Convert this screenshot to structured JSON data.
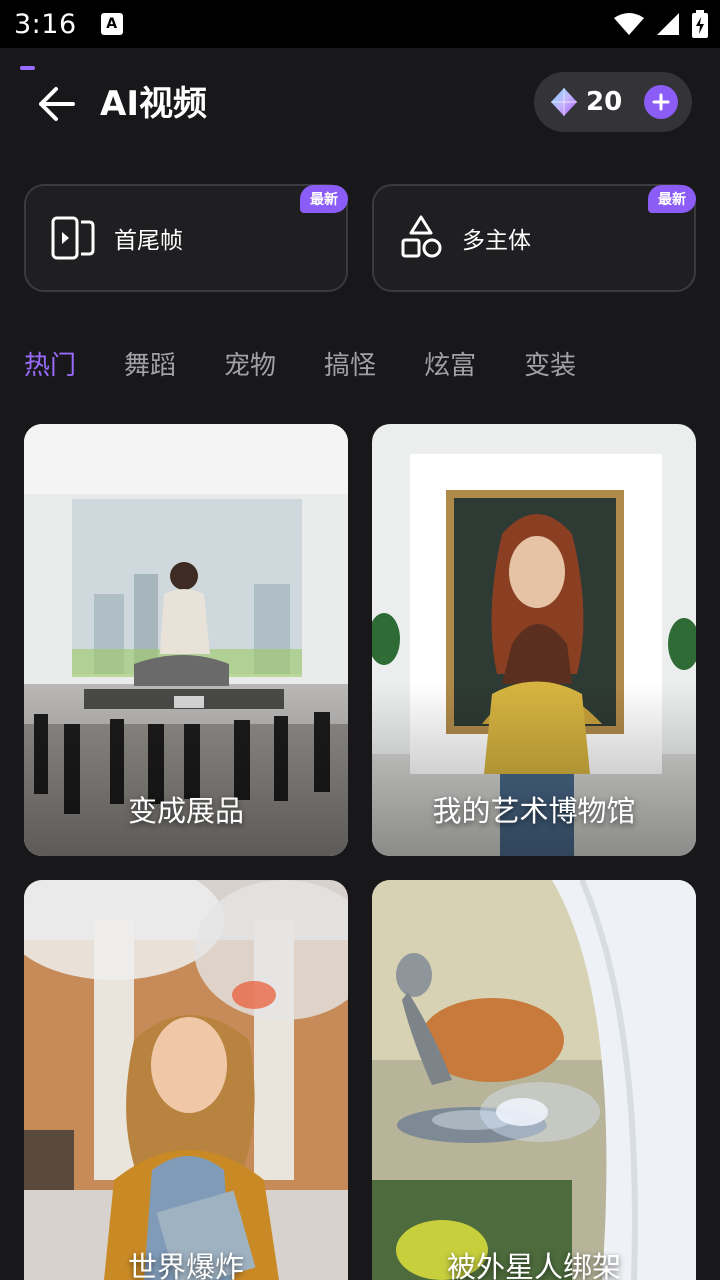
{
  "status_bar": {
    "time": "3:16",
    "notification_glyph": "A"
  },
  "header": {
    "title": "AI视频",
    "credits": "20"
  },
  "features": [
    {
      "label": "首尾帧",
      "badge": "最新",
      "icon": "door-frame-icon"
    },
    {
      "label": "多主体",
      "badge": "最新",
      "icon": "shapes-icon"
    }
  ],
  "tabs": [
    {
      "label": "热门",
      "active": true
    },
    {
      "label": "舞蹈"
    },
    {
      "label": "宠物"
    },
    {
      "label": "搞怪"
    },
    {
      "label": "炫富"
    },
    {
      "label": "变装"
    }
  ],
  "cards": [
    {
      "title": "变成展品"
    },
    {
      "title": "我的艺术博物馆"
    },
    {
      "title": "世界爆炸"
    },
    {
      "title": "被外星人绑架"
    }
  ],
  "colors": {
    "accent": "#8b5cf6",
    "tab_active": "#9a6bff",
    "background": "#18181a"
  }
}
